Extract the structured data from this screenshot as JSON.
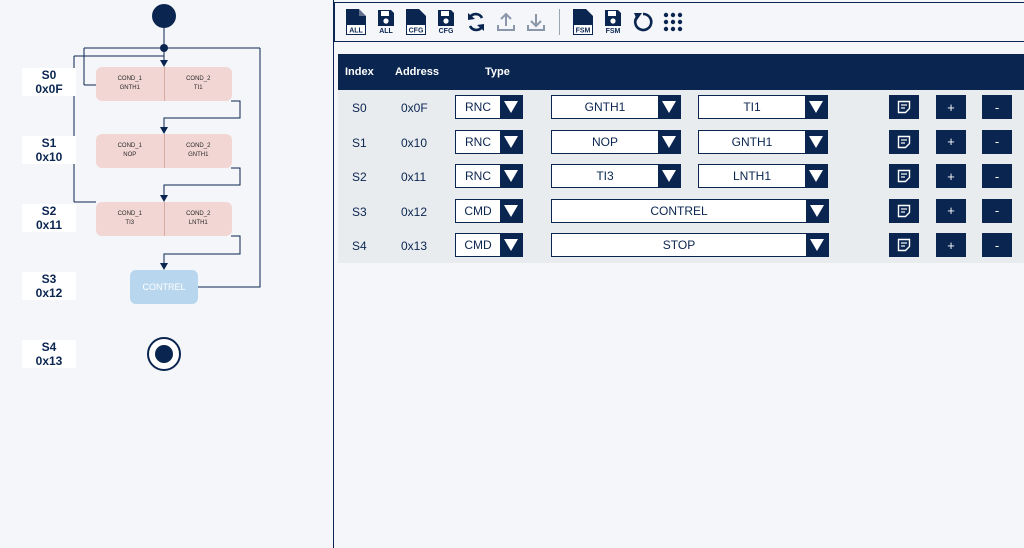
{
  "diagram": {
    "states": [
      {
        "name": "S0",
        "addr": "0x0F"
      },
      {
        "name": "S1",
        "addr": "0x10"
      },
      {
        "name": "S2",
        "addr": "0x11"
      },
      {
        "name": "S3",
        "addr": "0x12"
      },
      {
        "name": "S4",
        "addr": "0x13"
      }
    ],
    "nodes": [
      {
        "c1_label": "COND_1",
        "c1_value": "GNTH1",
        "c2_label": "COND_2",
        "c2_value": "TI1"
      },
      {
        "c1_label": "COND_1",
        "c1_value": "NOP",
        "c2_label": "COND_2",
        "c2_value": "GNTH1"
      },
      {
        "c1_label": "COND_1",
        "c1_value": "TI3",
        "c2_label": "COND_2",
        "c2_value": "LNTH1"
      }
    ],
    "control_node": "CONTREL"
  },
  "toolbar": {
    "buttons": [
      {
        "icon": "file-all-icon",
        "caption": ""
      },
      {
        "icon": "save-all-icon",
        "caption": "ALL"
      },
      {
        "icon": "file-cfg-icon",
        "caption": ""
      },
      {
        "icon": "save-cfg-icon",
        "caption": "CFG"
      },
      {
        "icon": "sync-icon",
        "caption": ""
      },
      {
        "icon": "upload-icon",
        "caption": ""
      },
      {
        "icon": "download-icon",
        "caption": ""
      },
      {
        "icon": "file-fsm-icon",
        "caption": ""
      },
      {
        "icon": "save-fsm-icon",
        "caption": "FSM"
      },
      {
        "icon": "reset-icon",
        "caption": ""
      },
      {
        "icon": "grid-menu-icon",
        "caption": ""
      }
    ],
    "file_badges": {
      "all": "ALL",
      "cfg": "CFG",
      "fsm": "FSM"
    }
  },
  "table": {
    "headers": {
      "index": "Index",
      "address": "Address",
      "type": "Type"
    },
    "rows": [
      {
        "index": "S0",
        "address": "0x0F",
        "type": "RNC",
        "cond1": "GNTH1",
        "cond2": "TI1",
        "wide": false
      },
      {
        "index": "S1",
        "address": "0x10",
        "type": "RNC",
        "cond1": "NOP",
        "cond2": "GNTH1",
        "wide": false
      },
      {
        "index": "S2",
        "address": "0x11",
        "type": "RNC",
        "cond1": "TI3",
        "cond2": "LNTH1",
        "wide": false
      },
      {
        "index": "S3",
        "address": "0x12",
        "type": "CMD",
        "cond1": "CONTREL",
        "cond2": "",
        "wide": true
      },
      {
        "index": "S4",
        "address": "0x13",
        "type": "CMD",
        "cond1": "STOP",
        "cond2": "",
        "wide": true
      }
    ],
    "actions": {
      "plus": "+",
      "minus": "-"
    }
  },
  "colors": {
    "primary": "#0a2550",
    "node": "#f2d6d4",
    "control": "#b8d6ee",
    "row_bg": "#e9ecef"
  }
}
